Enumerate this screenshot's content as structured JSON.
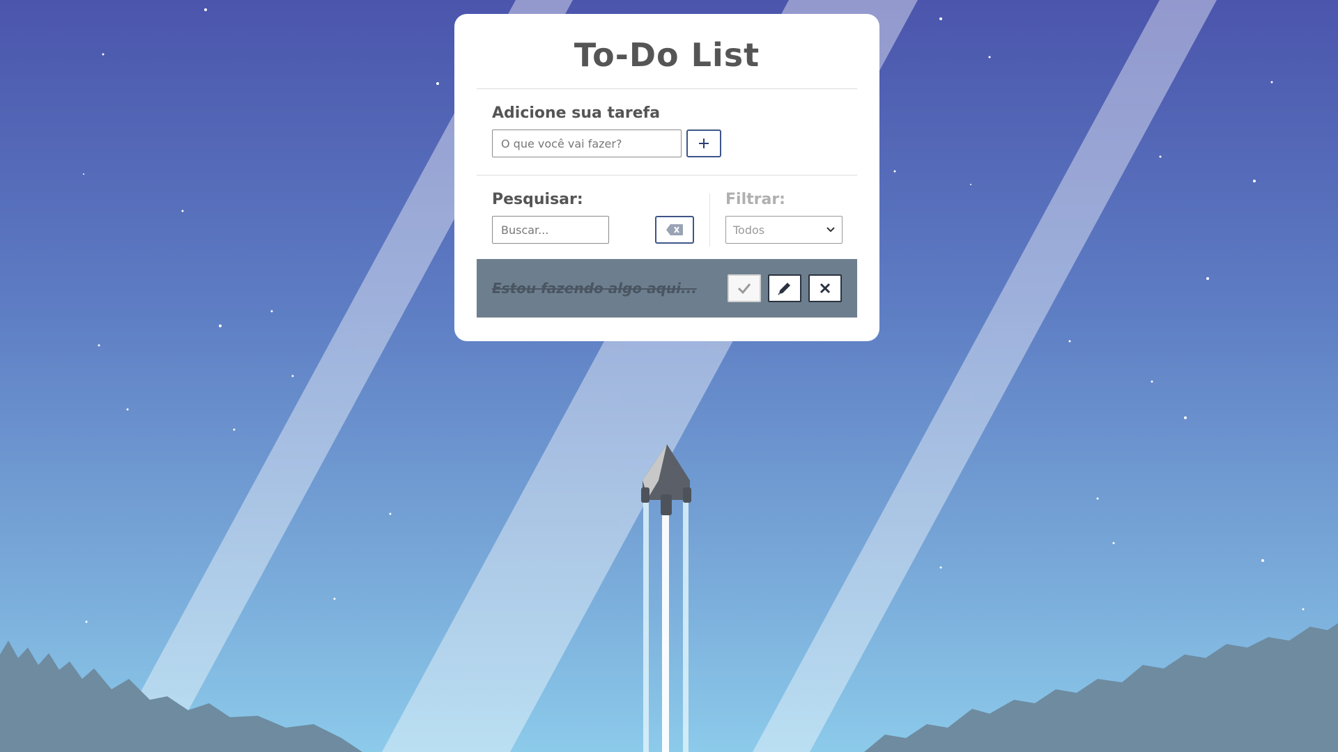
{
  "app": {
    "title": "To-Do List"
  },
  "add_form": {
    "label": "Adicione sua tarefa",
    "placeholder": "O que você vai fazer?",
    "submit_icon": "plus-icon"
  },
  "search": {
    "label": "Pesquisar:",
    "placeholder": "Buscar...",
    "clear_icon": "backspace-icon"
  },
  "filter": {
    "label": "Filtrar:",
    "selected": "Todos"
  },
  "todos": [
    {
      "text": "Estou fazendo algo aqui...",
      "done": true,
      "actions": [
        "check-icon",
        "pencil-icon",
        "close-icon"
      ]
    }
  ],
  "colors": {
    "sky_top": "#4b55ac",
    "sky_bottom": "#8ccaea",
    "card": "#ffffff",
    "todo_done_bg": "#6d7f8e",
    "accent_border": "#3d5588",
    "text": "#555555"
  }
}
